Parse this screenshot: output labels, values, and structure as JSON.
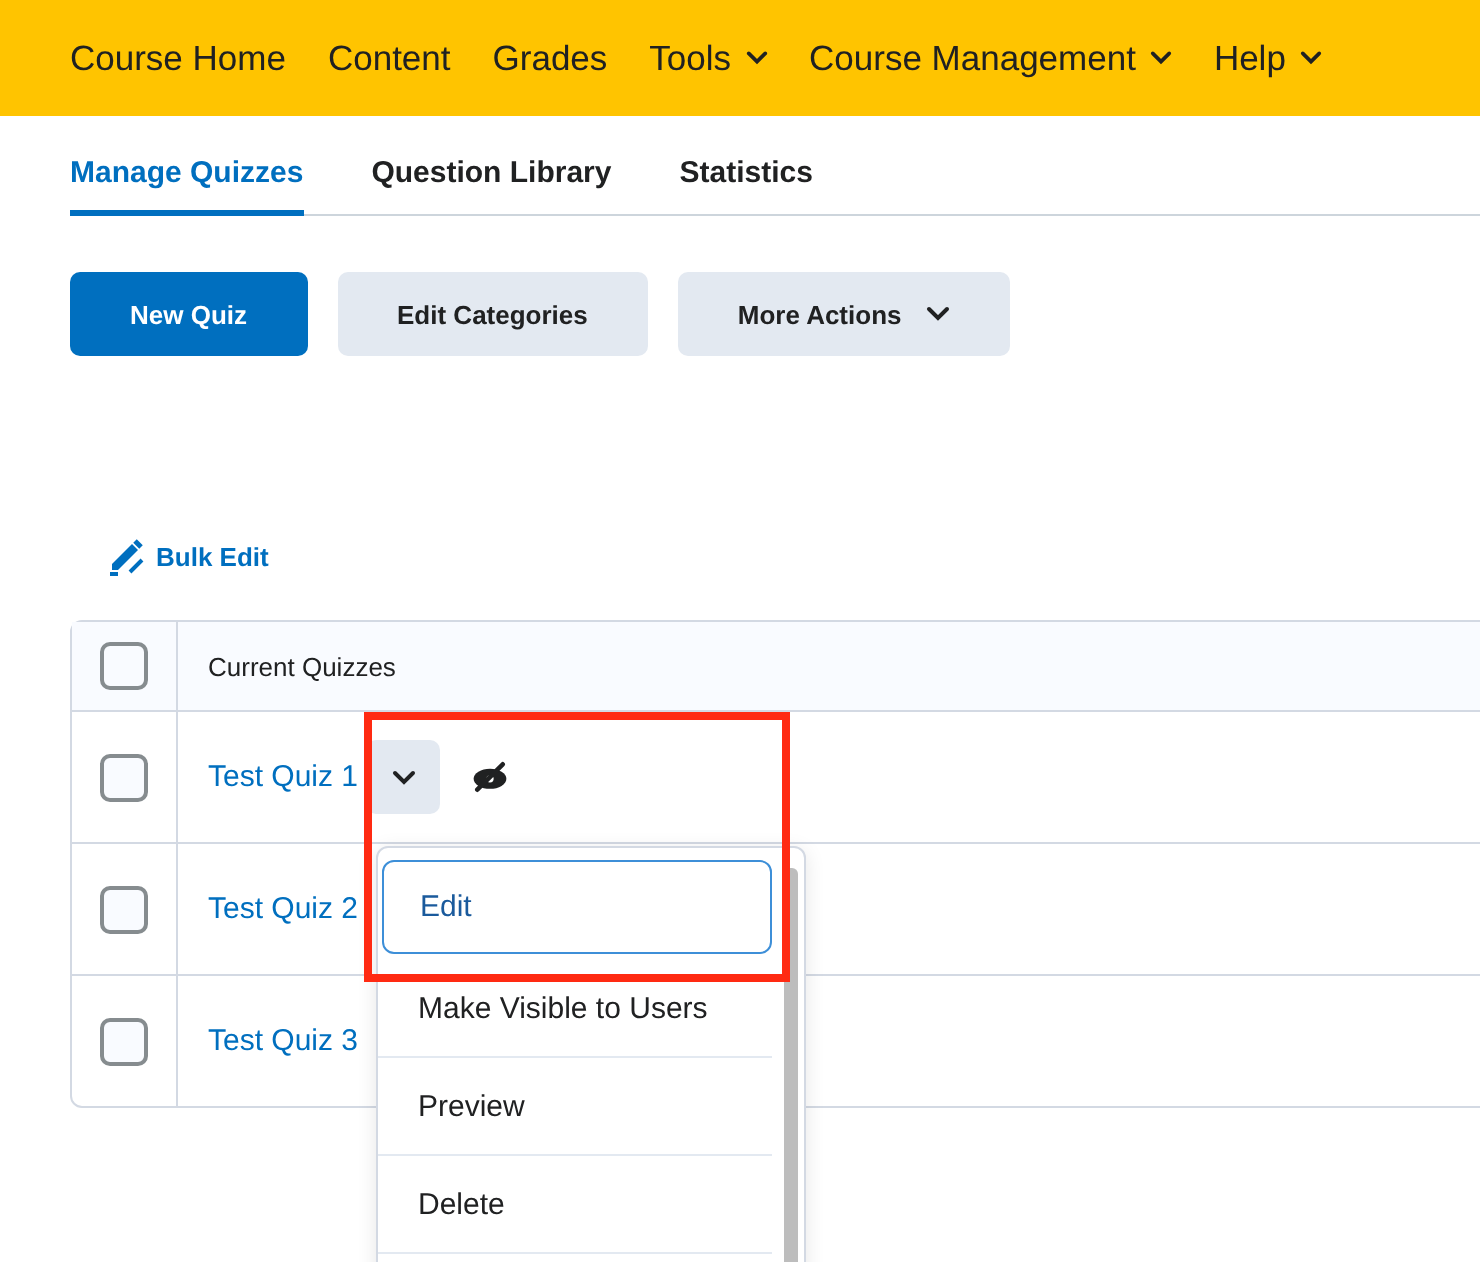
{
  "nav": [
    {
      "label": "Course Home",
      "has_menu": false
    },
    {
      "label": "Content",
      "has_menu": false
    },
    {
      "label": "Grades",
      "has_menu": false
    },
    {
      "label": "Tools",
      "has_menu": true
    },
    {
      "label": "Course Management",
      "has_menu": true
    },
    {
      "label": "Help",
      "has_menu": true
    }
  ],
  "tabs": [
    {
      "label": "Manage Quizzes",
      "selected": true
    },
    {
      "label": "Question Library",
      "selected": false
    },
    {
      "label": "Statistics",
      "selected": false
    }
  ],
  "buttons": [
    {
      "label": "New Quiz",
      "kind": "primary"
    },
    {
      "label": "Edit Categories",
      "kind": "secondary"
    },
    {
      "label": "More Actions",
      "kind": "menu"
    }
  ],
  "bulk_edit": "Bulk Edit",
  "table": {
    "header": "Current Quizzes",
    "header_checked": false,
    "rows": [
      {
        "name": "Test Quiz 1",
        "checked": false,
        "hovered": true
      },
      {
        "name": "Test Quiz 2",
        "checked": false,
        "hovered": false
      },
      {
        "name": "Test Quiz 3",
        "checked": false,
        "hovered": false
      }
    ]
  },
  "context_menu": {
    "items": [
      {
        "label": "Edit",
        "focused": true
      },
      {
        "label": "Make Visible to Users",
        "focused": false
      },
      {
        "label": "Preview",
        "focused": false
      },
      {
        "label": "Delete",
        "focused": false
      }
    ]
  },
  "highlight": true
}
